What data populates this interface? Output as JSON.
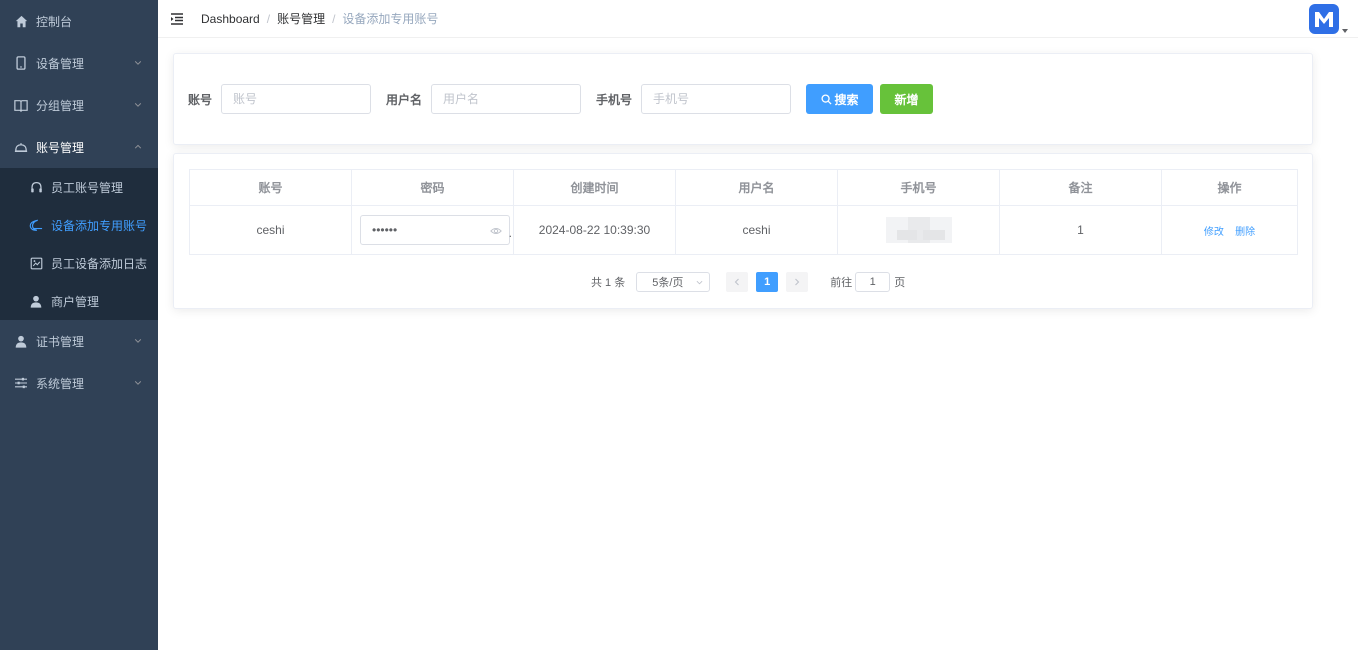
{
  "sidebar": {
    "items": [
      {
        "label": "控制台",
        "icon": "home-icon"
      },
      {
        "label": "设备管理",
        "icon": "mobile-icon"
      },
      {
        "label": "分组管理",
        "icon": "book-icon"
      },
      {
        "label": "账号管理",
        "icon": "bell-icon"
      },
      {
        "label": "证书管理",
        "icon": "user-icon"
      },
      {
        "label": "系统管理",
        "icon": "sliders-icon"
      }
    ],
    "account_sub": [
      {
        "label": "员工账号管理",
        "icon": "headset-icon"
      },
      {
        "label": "设备添加专用账号",
        "icon": "moon-icon"
      },
      {
        "label": "员工设备添加日志",
        "icon": "picture-icon"
      },
      {
        "label": "商户管理",
        "icon": "user-icon"
      }
    ]
  },
  "navbar": {
    "breadcrumb": [
      "Dashboard",
      "账号管理",
      "设备添加专用账号"
    ],
    "separator": "/"
  },
  "search": {
    "account_label": "账号",
    "account_placeholder": "账号",
    "username_label": "用户名",
    "username_placeholder": "用户名",
    "phone_label": "手机号",
    "phone_placeholder": "手机号",
    "search_btn": "搜索",
    "add_btn": "新增"
  },
  "table": {
    "headers": [
      "账号",
      "密码",
      "创建时间",
      "用户名",
      "手机号",
      "备注",
      "操作"
    ],
    "rows": [
      {
        "account": "ceshi",
        "password": "••••••",
        "password_trail": ".",
        "created": "2024-08-22 10:39:30",
        "username": "ceshi",
        "remark": "1",
        "edit": "修改",
        "delete": "删除"
      }
    ]
  },
  "pager": {
    "total": "共 1 条",
    "page_size": "5条/页",
    "current_page": "1",
    "goto_prefix": "前往",
    "goto_value": "1",
    "goto_suffix": "页"
  },
  "colors": {
    "sidebar_bg": "#304156",
    "submenu_bg": "#1f2d3d",
    "primary": "#409eff",
    "success": "#67c23a"
  }
}
